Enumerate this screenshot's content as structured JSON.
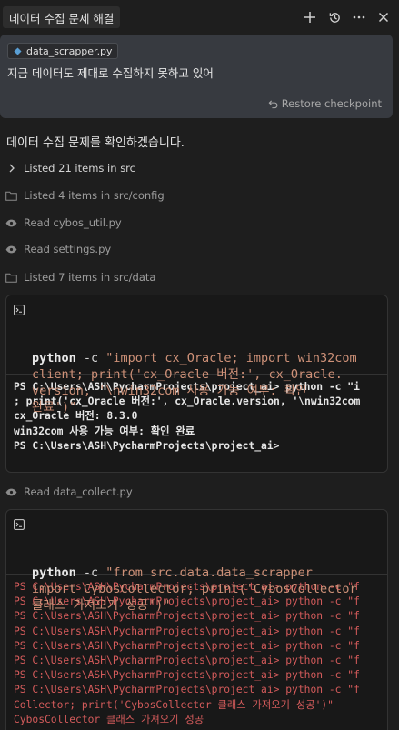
{
  "header": {
    "title": "데이터 수집 문제 해결",
    "icons": [
      "plus-icon",
      "history-icon",
      "more-icon",
      "close-icon"
    ]
  },
  "prompt": {
    "file_chip": "data_scrapper.py",
    "text": "지금 데이터도 제대로 수집하지 못하고 있어",
    "restore_label": "Restore checkpoint"
  },
  "assistant": {
    "message": "데이터 수집 문제를 확인하겠습니다.",
    "steps": [
      {
        "label": "Listed 21 items in src",
        "icon": "chevron-right-icon"
      },
      {
        "label": "Listed 4 items in src/config",
        "icon": "folder-icon"
      },
      {
        "label": "Read cybos_util.py",
        "icon": "eye-icon"
      },
      {
        "label": "Read settings.py",
        "icon": "eye-icon"
      },
      {
        "label": "Listed 7 items in src/data",
        "icon": "folder-icon"
      },
      {
        "label": "Read data_collect.py",
        "icon": "eye-icon"
      }
    ]
  },
  "terminal1": {
    "command_lines": [
      "python -c \"import cx_Oracle; import win32com",
      "client; print('cx_Oracle 버전:', cx_Oracle.",
      "version, '\\nwin32com 사용 가능 여부: 확인",
      "완료')\""
    ],
    "output_lines": [
      "PS C:\\Users\\ASH\\PycharmProjects\\project_ai> python -c \"i",
      "; print('cx_Oracle 버전:', cx_Oracle.version, '\\nwin32com",
      "cx_Oracle 버전: 8.3.0",
      "win32com 사용 가능 여부: 확인 완료",
      "PS C:\\Users\\ASH\\PycharmProjects\\project_ai>"
    ]
  },
  "terminal2": {
    "command_lines": [
      "python -c \"from src.data.data_scrapper",
      "import CybosCollector; print('CybosCollector",
      "클래스 가져오기 성공')\""
    ],
    "output_lines": [
      "PS C:\\Users\\ASH\\PycharmProjects\\project_ai> python -c \"f",
      "PS C:\\Users\\ASH\\PycharmProjects\\project_ai> python -c \"f",
      "PS C:\\Users\\ASH\\PycharmProjects\\project_ai> python -c \"f",
      "PS C:\\Users\\ASH\\PycharmProjects\\project_ai> python -c \"f",
      "PS C:\\Users\\ASH\\PycharmProjects\\project_ai> python -c \"f",
      "PS C:\\Users\\ASH\\PycharmProjects\\project_ai> python -c \"f",
      "PS C:\\Users\\ASH\\PycharmProjects\\project_ai> python -c \"f",
      "PS C:\\Users\\ASH\\PycharmProjects\\project_ai> python -c \"f"
    ],
    "output_tail": "Collector; print('CybosCollector 클래스 가져오기 성공')\"",
    "output_last": "CybosCollector 클래스 가져오기 성공"
  },
  "colors": {
    "background": "#1e1e1e",
    "prompt_card": "#373a40",
    "terminal_bg": "#181818",
    "string": "#ce9178",
    "error_red": "#d45b5b"
  }
}
